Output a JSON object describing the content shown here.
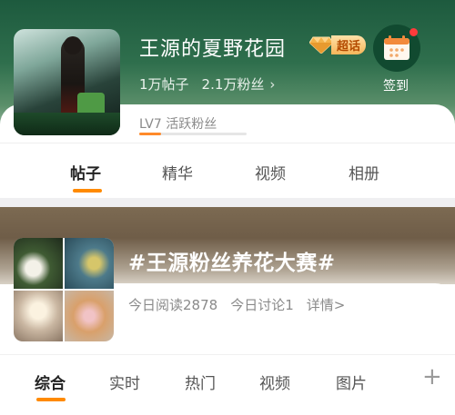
{
  "super_topic": {
    "name": "王源的夏野花园",
    "badge_label": "超话",
    "posts": "1万帖子",
    "fans": "2.1万粉丝",
    "checkin_label": "签到",
    "level_text": "LV7 活跃粉丝",
    "level_progress_pct": 20,
    "tabs": [
      {
        "label": "帖子"
      },
      {
        "label": "精华"
      },
      {
        "label": "视频"
      },
      {
        "label": "相册"
      }
    ]
  },
  "hashtag_topic": {
    "title": "#王源粉丝养花大赛#",
    "reads": "今日阅读2878",
    "discussions": "今日讨论1",
    "details": "详情>",
    "tabs": [
      {
        "label": "综合"
      },
      {
        "label": "实时"
      },
      {
        "label": "热门"
      },
      {
        "label": "视频"
      },
      {
        "label": "图片"
      }
    ],
    "plus_icon": "+"
  },
  "colors": {
    "accent": "#ff8a00",
    "checkin_dot": "#ff3b3b"
  }
}
